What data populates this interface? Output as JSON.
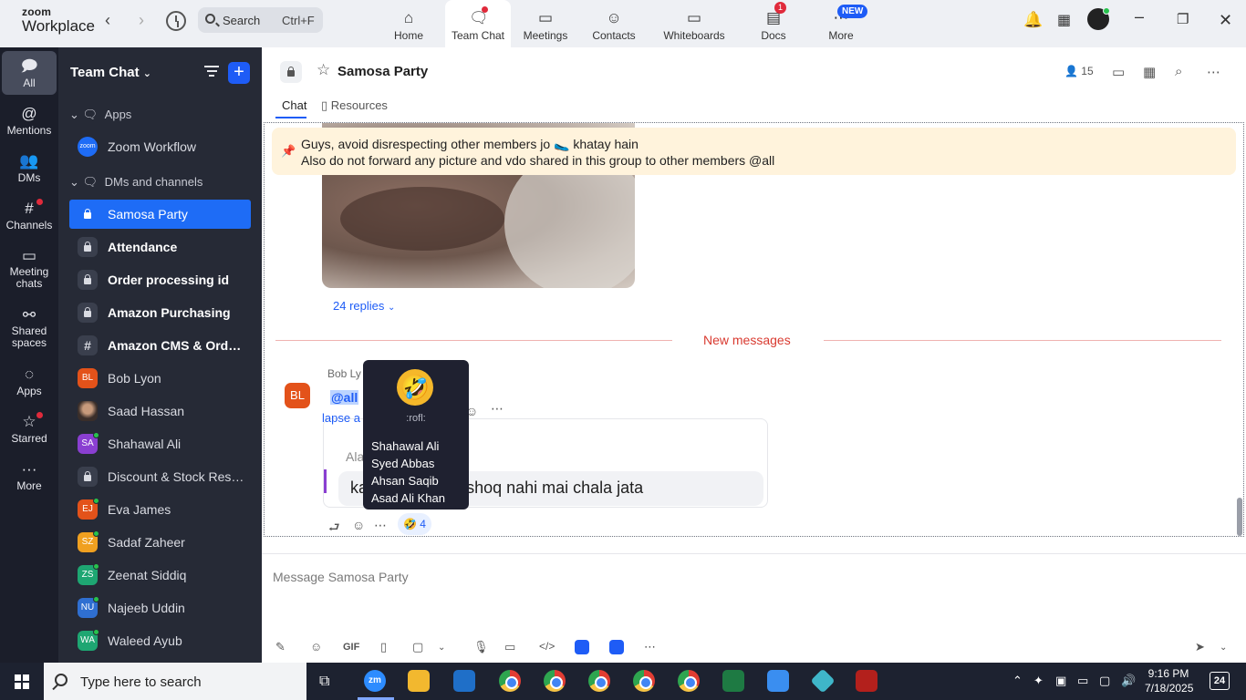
{
  "topbar": {
    "logo_line1": "zoom",
    "logo_line2": "Workplace",
    "search_placeholder": "Search",
    "search_shortcut": "Ctrl+F",
    "tabs": [
      {
        "label": "Home",
        "icon": "home-icon"
      },
      {
        "label": "Team Chat",
        "icon": "chat-icon"
      },
      {
        "label": "Meetings",
        "icon": "video-icon"
      },
      {
        "label": "Contacts",
        "icon": "contacts-icon"
      },
      {
        "label": "Whiteboards",
        "icon": "whiteboard-icon"
      },
      {
        "label": "Docs",
        "icon": "docs-icon",
        "badge": "1"
      },
      {
        "label": "More",
        "icon": "more-icon",
        "badge": "NEW"
      }
    ]
  },
  "rail": {
    "items": [
      {
        "label": "All",
        "icon": "chat-bubble-icon"
      },
      {
        "label": "Mentions",
        "icon": "at-icon"
      },
      {
        "label": "DMs",
        "icon": "people-icon"
      },
      {
        "label": "Channels",
        "icon": "hash-icon"
      },
      {
        "label": "Meeting chats",
        "icon": "calendar-icon"
      },
      {
        "label": "Shared spaces",
        "icon": "shared-icon"
      },
      {
        "label": "Apps",
        "icon": "apps-icon"
      },
      {
        "label": "Starred",
        "icon": "star-icon"
      },
      {
        "label": "More",
        "icon": "ellipsis-icon"
      }
    ]
  },
  "sidebar": {
    "title": "Team Chat",
    "sections": {
      "apps": "Apps",
      "dms": "DMs and channels"
    },
    "items": [
      {
        "label": "Zoom Workflow",
        "kind": "app",
        "avatar": "zoom"
      },
      {
        "label": "Samosa Party",
        "kind": "lock",
        "active": true
      },
      {
        "label": "Attendance",
        "kind": "lock",
        "bold": true
      },
      {
        "label": "Order processing id",
        "kind": "lock",
        "bold": true
      },
      {
        "label": "Amazon Purchasing",
        "kind": "lock",
        "bold": true
      },
      {
        "label": "Amazon CMS & Order...",
        "kind": "hash",
        "bold": true
      },
      {
        "label": "Bob Lyon",
        "kind": "avatar",
        "avatar": "BL",
        "color": "#e3521a"
      },
      {
        "label": "Saad Hassan",
        "kind": "photo"
      },
      {
        "label": "Shahawal Ali",
        "kind": "avatar",
        "avatar": "SA",
        "color": "#8a3fd1",
        "online": true
      },
      {
        "label": "Discount & Stock Reser...",
        "kind": "lock"
      },
      {
        "label": "Eva James",
        "kind": "avatar",
        "avatar": "EJ",
        "color": "#e3521a",
        "online": true
      },
      {
        "label": "Sadaf Zaheer",
        "kind": "avatar",
        "avatar": "SZ",
        "color": "#f0a020",
        "online": true
      },
      {
        "label": "Zeenat Siddiq",
        "kind": "avatar",
        "avatar": "ZS",
        "color": "#1ea672",
        "online": true
      },
      {
        "label": "Najeeb Uddin",
        "kind": "avatar",
        "avatar": "NU",
        "color": "#2f6fd1",
        "online": true
      },
      {
        "label": "Waleed Ayub",
        "kind": "avatar",
        "avatar": "WA",
        "color": "#1ea672",
        "online": true
      }
    ]
  },
  "channel": {
    "title": "Samosa Party",
    "member_count": "15",
    "tabs": {
      "chat": "Chat",
      "resources": "Resources"
    },
    "pinned_line1": "Guys, avoid disrespecting other members jo 🥿 khatay hain",
    "pinned_line2": "Also do not forward any picture and vdo shared in this group to other members @all",
    "replies": "24 replies",
    "new_messages": "New messages",
    "message": {
      "avatar": "BL",
      "sender": "Bob Ly",
      "mention": "@all",
      "quote_ref": "lapse a",
      "quote_name": "Ala",
      "quote_text": "ka                 hi rehnay ka shoq nahi mai chala jata",
      "reaction_count": "4"
    },
    "tooltip": {
      "emoji": "🤣",
      "code": ":rofl:",
      "names": [
        "Shahawal Ali",
        "Syed Abbas",
        "Ahsan Saqib",
        "Asad Ali Khan"
      ]
    },
    "composer_placeholder": "Message Samosa Party"
  },
  "taskbar": {
    "search_placeholder": "Type here to search",
    "time": "9:16 PM",
    "date": "7/18/2025",
    "notifications": "24"
  }
}
